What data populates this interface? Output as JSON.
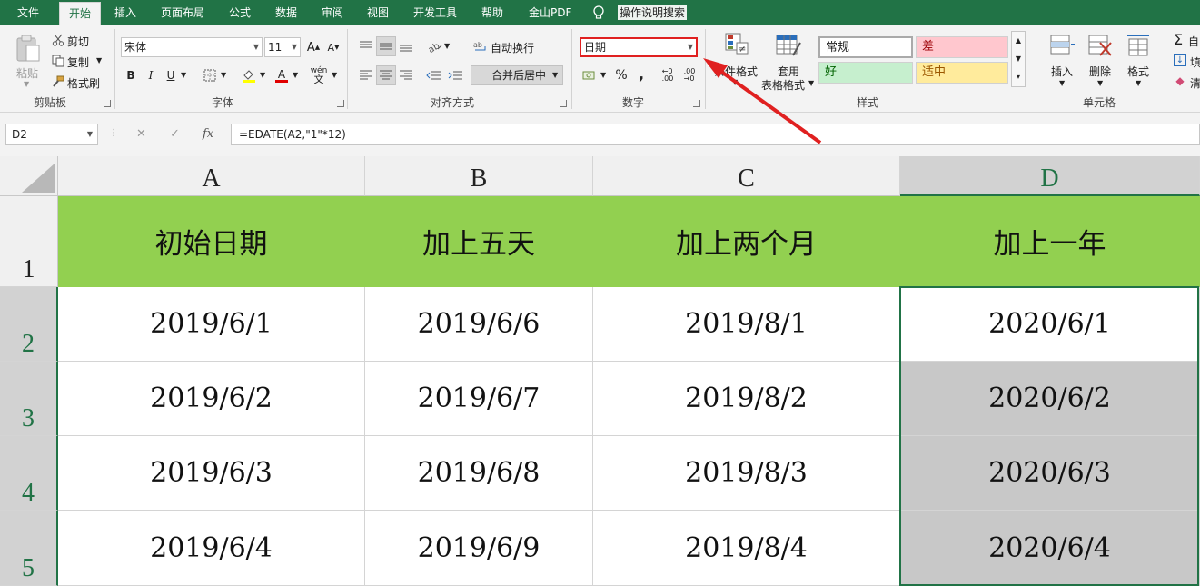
{
  "menu": {
    "tabs": [
      "文件",
      "开始",
      "插入",
      "页面布局",
      "公式",
      "数据",
      "审阅",
      "视图",
      "开发工具",
      "帮助",
      "金山PDF"
    ],
    "active_tab": "开始",
    "tell_me": "操作说明搜索"
  },
  "ribbon": {
    "clipboard": {
      "label": "剪贴板",
      "paste": "粘贴",
      "cut": "剪切",
      "copy": "复制",
      "format_painter": "格式刷"
    },
    "font": {
      "label": "字体",
      "font_name": "宋体",
      "font_size": "11",
      "bold": "B",
      "italic": "I",
      "underline": "U",
      "phonetic": "wén"
    },
    "alignment": {
      "label": "对齐方式",
      "wrap": "自动换行",
      "merge": "合并后居中"
    },
    "number": {
      "label": "数字",
      "format": "日期",
      "percent": "%",
      "comma": ","
    },
    "styles": {
      "label": "样式",
      "conditional": "条件格式",
      "table_line1": "套用",
      "table_line2": "表格格式",
      "normal": "常规",
      "bad": "差",
      "good": "好",
      "neutral": "适中"
    },
    "cells": {
      "label": "单元格",
      "insert": "插入",
      "delete": "删除",
      "format": "格式"
    },
    "editing": {
      "fill": "填",
      "clear": "清"
    }
  },
  "formula_bar": {
    "name_box": "D2",
    "formula": "=EDATE(A2,\"1\"*12)",
    "cancel": "✕",
    "enter": "✓",
    "fx": "fx"
  },
  "sheet": {
    "columns": [
      "A",
      "B",
      "C",
      "D"
    ],
    "rows": [
      "1",
      "2",
      "3",
      "4",
      "5"
    ],
    "header_row": [
      "初始日期",
      "加上五天",
      "加上两个月",
      "加上一年"
    ],
    "data": [
      [
        "2019/6/1",
        "2019/6/6",
        "2019/8/1",
        "2020/6/1"
      ],
      [
        "2019/6/2",
        "2019/6/7",
        "2019/8/2",
        "2020/6/2"
      ],
      [
        "2019/6/3",
        "2019/6/8",
        "2019/8/3",
        "2020/6/3"
      ],
      [
        "2019/6/4",
        "2019/6/9",
        "2019/8/4",
        "2020/6/4"
      ]
    ]
  },
  "colors": {
    "brand_green": "#217346",
    "header_fill": "#92d050",
    "selection_gray": "#c8c8c8",
    "annotation_red": "#e02020"
  }
}
